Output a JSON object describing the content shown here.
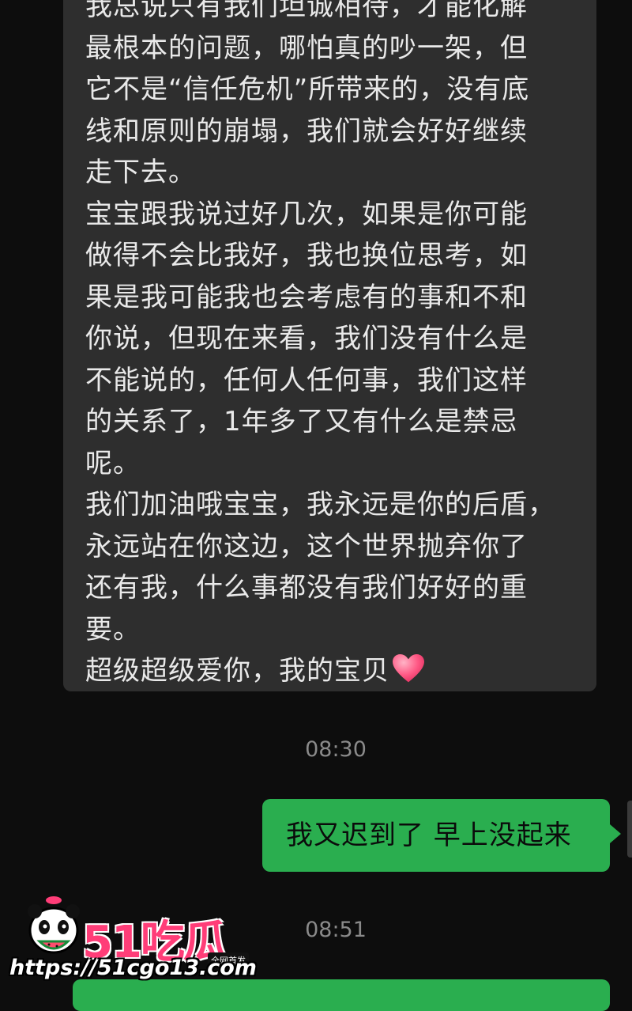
{
  "incoming_message": {
    "lines": [
      "我总说只有我们坦诚相待，才能化解",
      "最根本的问题，哪怕真的吵一架，但",
      "它不是“信任危机”所带来的，没有底",
      "线和原则的崩塌，我们就会好好继续",
      "走下去。",
      "宝宝跟我说过好几次，如果是你可能",
      "做得不会比我好，我也换位思考，如",
      "果是我可能我也会考虑有的事和不和",
      "你说，但现在来看，我们没有什么是",
      "不能说的，任何人任何事，我们这样",
      "的关系了，1年多了又有什么是禁忌",
      "呢。",
      "我们加油哦宝宝，我永远是你的后盾，",
      "永远站在你这边，这个世界抛弃你了",
      "还有我，什么事都没有我们好好的重",
      "要。",
      "超级超级爱你，我的宝贝"
    ],
    "emoji": "heart-emoji"
  },
  "timestamps": [
    "08:30",
    "08:51"
  ],
  "outgoing_message": {
    "text": "我又迟到了 早上没起来"
  },
  "watermark": {
    "brand": "51吃瓜",
    "tag": "全网首发",
    "url": "https://51cgo13.com"
  },
  "colors": {
    "background": "#0d0d0d",
    "incoming_bubble": "#2e2e2e",
    "outgoing_bubble": "#2aae4f",
    "timestamp": "#8a8a8a",
    "brand": "#ff3d78"
  }
}
